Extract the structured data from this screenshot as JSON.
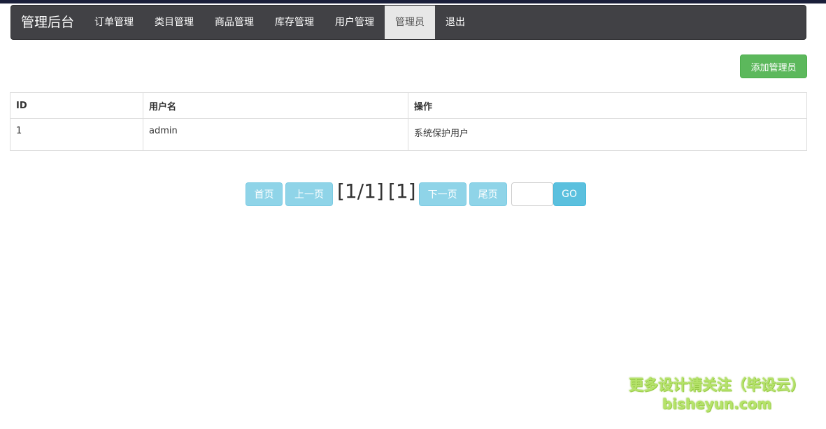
{
  "navbar": {
    "brand": "管理后台",
    "items": [
      {
        "label": "订单管理"
      },
      {
        "label": "类目管理"
      },
      {
        "label": "商品管理"
      },
      {
        "label": "库存管理"
      },
      {
        "label": "用户管理"
      },
      {
        "label": "管理员",
        "active": true
      },
      {
        "label": "退出"
      }
    ]
  },
  "actions": {
    "add_admin_label": "添加管理员"
  },
  "table": {
    "columns": [
      "ID",
      "用户名",
      "操作"
    ],
    "rows": [
      {
        "id": "1",
        "username": "admin",
        "operation": "系统保护用户"
      }
    ]
  },
  "pagination": {
    "first_label": "首页",
    "prev_label": "上一页",
    "page_info": "[1/1]",
    "current_page": "[1]",
    "next_label": "下一页",
    "last_label": "尾页",
    "input_value": "",
    "go_label": "GO"
  },
  "watermark": {
    "line1": "更多设计请关注（毕设云）",
    "line2": "bisheyun.com"
  },
  "colors": {
    "navbar_bg": "#414145",
    "add_button": "#5cb85c",
    "pager_button": "#8fd4e8",
    "go_button": "#5bc0de"
  }
}
